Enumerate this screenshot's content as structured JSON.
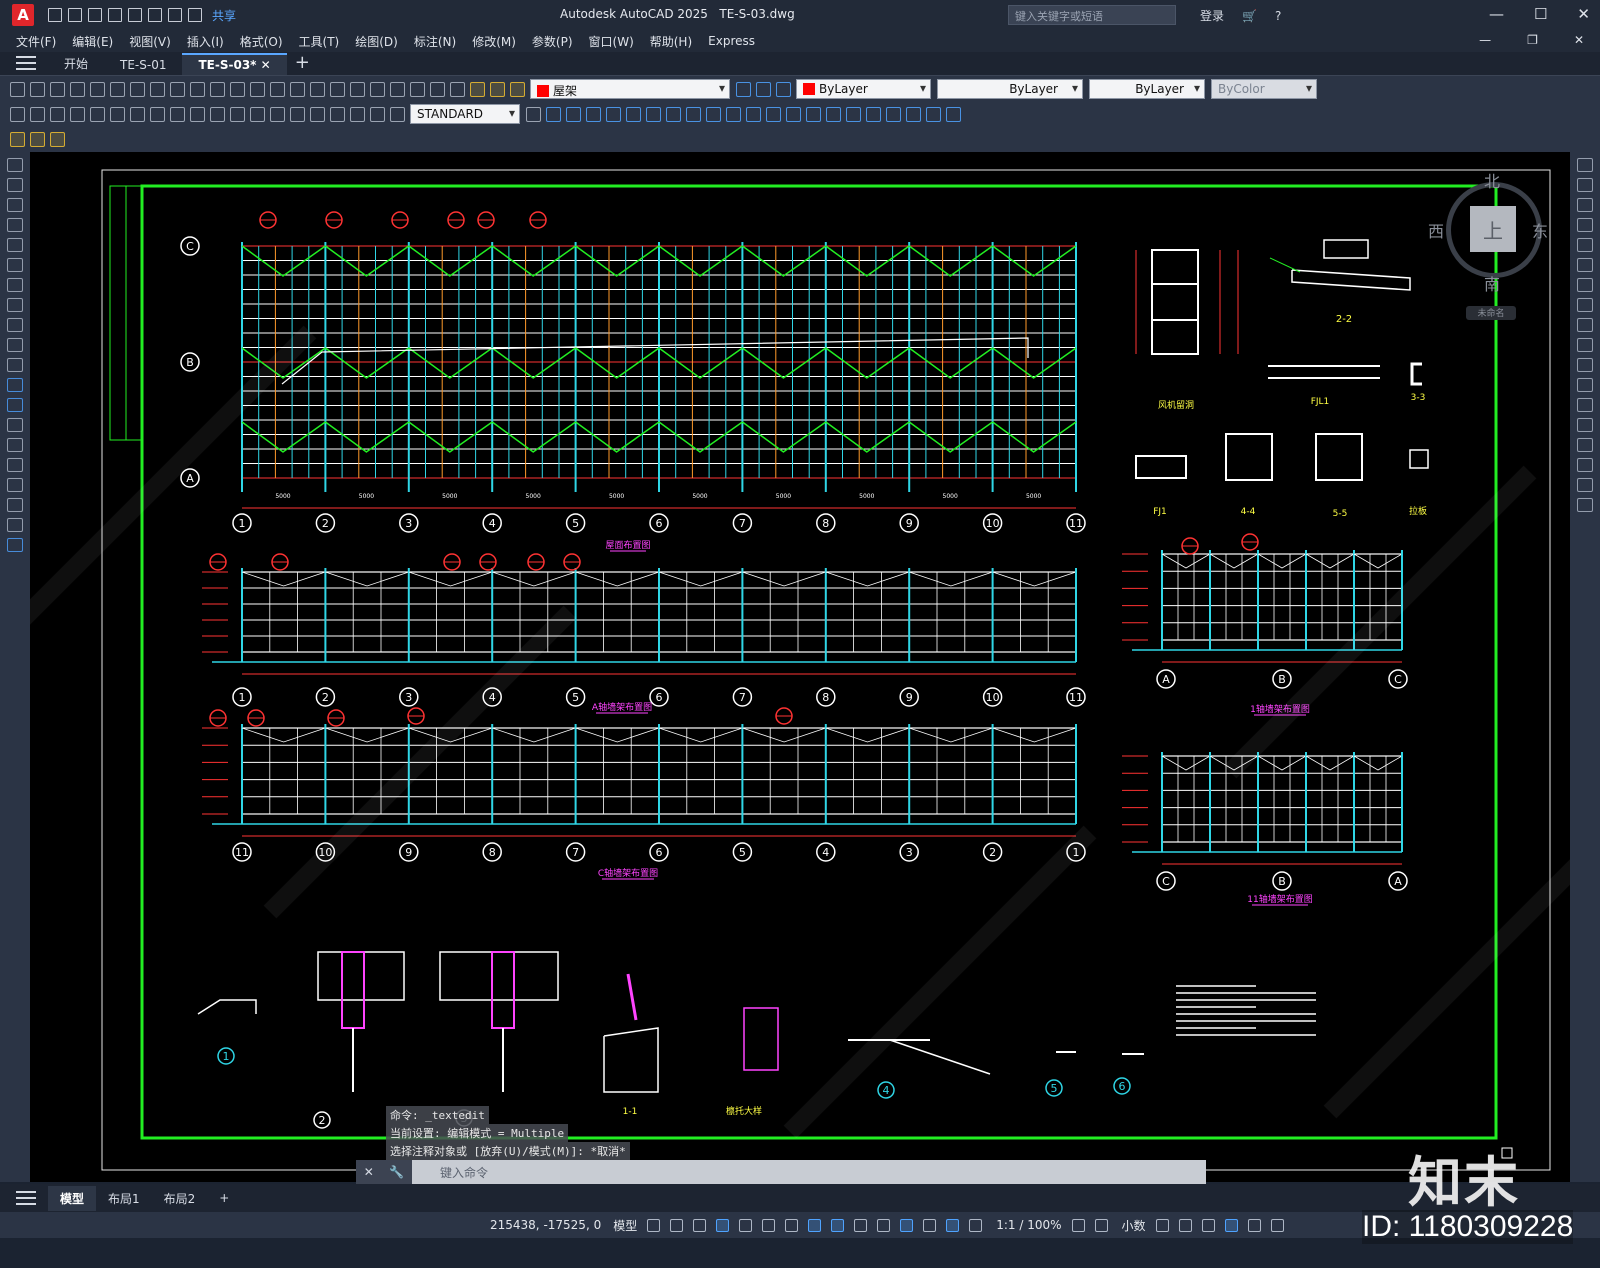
{
  "app": {
    "title": "Autodesk AutoCAD 2025",
    "file": "TE-S-03.dwg",
    "search_placeholder": "键入关键字或短语",
    "login": "登录",
    "share": "共享"
  },
  "menu": [
    "文件(F)",
    "编辑(E)",
    "视图(V)",
    "插入(I)",
    "格式(O)",
    "工具(T)",
    "绘图(D)",
    "标注(N)",
    "修改(M)",
    "参数(P)",
    "窗口(W)",
    "帮助(H)",
    "Express"
  ],
  "tabs": [
    {
      "label": "开始"
    },
    {
      "label": "TE-S-01"
    },
    {
      "label": "TE-S-03*",
      "active": true
    }
  ],
  "toolbar": {
    "layer": "屋架",
    "color": "ByLayer",
    "linetype": "ByLayer",
    "lineweight": "ByLayer",
    "plotstyle": "ByColor",
    "textstyle": "STANDARD"
  },
  "viewcube": {
    "north": "北",
    "south": "南",
    "west": "西",
    "east": "东",
    "top": "上",
    "wcs": "未命名"
  },
  "drawing": {
    "grid_axes_bottom": [
      "1",
      "2",
      "3",
      "4",
      "5",
      "6",
      "7",
      "8",
      "9",
      "10",
      "11"
    ],
    "grid_axes_c_elev": [
      "11",
      "10",
      "9",
      "8",
      "7",
      "6",
      "5",
      "4",
      "3",
      "2",
      "1"
    ],
    "rows": [
      "C",
      "B",
      "A"
    ],
    "bay_dim": "5000",
    "titles": {
      "roof_plan": "屋面布置图",
      "a_elev": "A轴墙架布置图",
      "c_elev": "C轴墙架布置图",
      "axis1_elev": "1轴墙架布置图",
      "axis11_elev": "11轴墙架布置图",
      "sec22": "2-2",
      "sec33": "3-3",
      "sec44": "4-4",
      "sec55": "5-5",
      "sec11": "1-1",
      "fj1": "FJ1",
      "fjl1": "FJL1",
      "wind": "风机留洞",
      "hook": "拉板",
      "bigdet": "檩托大样"
    },
    "detail_nos": [
      "1",
      "2",
      "3",
      "4",
      "5",
      "6"
    ],
    "gable_axes_1": [
      "A",
      "B",
      "C"
    ],
    "gable_axes_11": [
      "C",
      "B",
      "A"
    ]
  },
  "command": {
    "history": [
      "命令: _textedit",
      "当前设置: 编辑模式 = Multiple",
      "选择注释对象或 [放弃(U)/模式(M)]: *取消*"
    ],
    "placeholder": "键入命令"
  },
  "layouts": [
    {
      "label": "模型",
      "active": true
    },
    {
      "label": "布局1"
    },
    {
      "label": "布局2"
    }
  ],
  "status": {
    "coords": "215438, -17525, 0",
    "space": "模型",
    "scale": "1:1 / 100%",
    "units": "小数"
  },
  "watermark": {
    "logo": "知末",
    "id": "ID: 1180309228"
  }
}
